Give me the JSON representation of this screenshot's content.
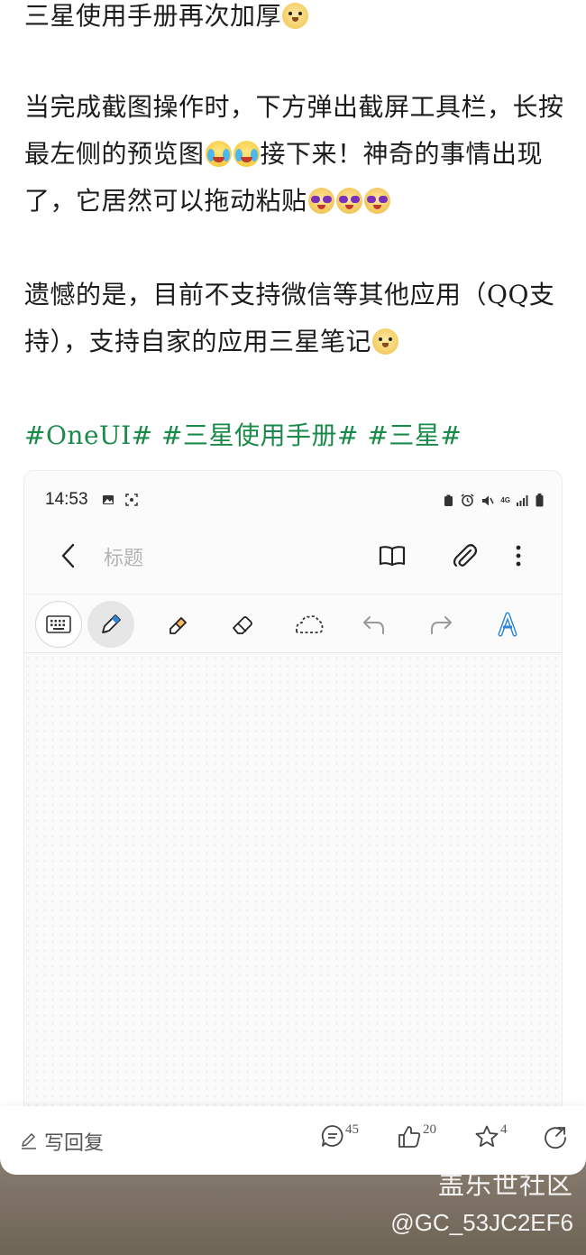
{
  "article": {
    "line1": "三星使用手册再次加厚",
    "para2": {
      "a": "当完成截图操作时，下方弹出截屏工具栏，长按最左侧的预览图",
      "b": "接下来！神奇的事情出现了，它居然可以拖动粘贴"
    },
    "para3": "遗憾的是，目前不支持微信等其他应用（QQ支持），支持自家的应用三星笔记",
    "tags": "#OneUI# #三星使用手册# #三星#"
  },
  "screenshot": {
    "status_time": "14:53",
    "status_network": "4G",
    "title_placeholder": "标题",
    "icons": {
      "back": "chevron-left-icon",
      "book": "book-icon",
      "attach": "paperclip-icon",
      "more": "more-vert-icon",
      "keyboard": "keyboard-icon",
      "pen": "pen-icon",
      "highlighter": "highlighter-icon",
      "eraser": "eraser-icon",
      "lasso": "lasso-icon",
      "undo": "undo-icon",
      "redo": "redo-icon",
      "text_recognize": "text-style-icon"
    }
  },
  "bottombar": {
    "reply_label": "写回复",
    "comments": "45",
    "likes": "20",
    "favorites": "4"
  },
  "watermark": {
    "brand": "盖乐世社区",
    "user": "@GC_53JC2EF6"
  },
  "colors": {
    "tag": "#1a8a4a",
    "pen_active": "#2f86d6",
    "highlighter": "#f4b860"
  }
}
